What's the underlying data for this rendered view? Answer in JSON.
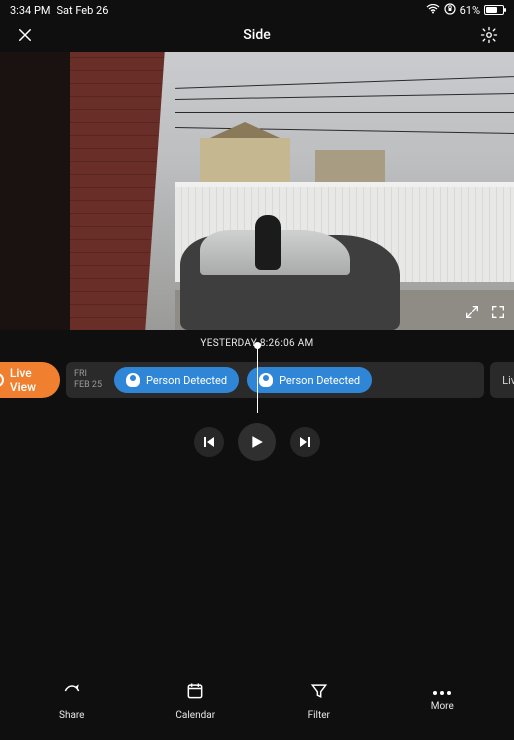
{
  "status": {
    "time": "3:34 PM",
    "date": "Sat Feb 26",
    "battery_pct": "61%"
  },
  "header": {
    "title": "Side"
  },
  "timestamp": "YESTERDAY 8:26:06 AM",
  "timeline": {
    "live_view_label": "Live View",
    "date_day": "FRI",
    "date_month": "FEB 25",
    "events": [
      {
        "label": "Person Detected"
      },
      {
        "label": "Person Detected"
      }
    ],
    "live_chip": "Live"
  },
  "bottom": {
    "share": "Share",
    "calendar": "Calendar",
    "filter": "Filter",
    "more": "More"
  }
}
